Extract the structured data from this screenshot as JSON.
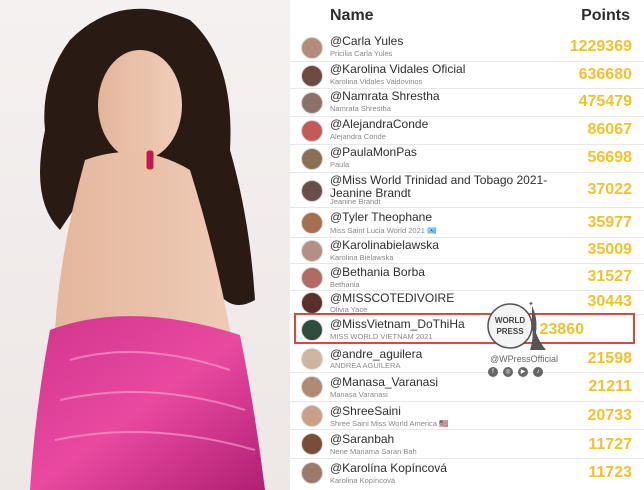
{
  "header": {
    "name_label": "Name",
    "points_label": "Points"
  },
  "rows": [
    {
      "username": "@Carla Yules",
      "fullname": "Pricilia Carla Yules",
      "points": "1229369",
      "color": "#b38b7b"
    },
    {
      "username": "@Karolina Vidales Oficial",
      "fullname": "Karolina Vidales Valdovinos",
      "points": "636680",
      "color": "#6d4b3e"
    },
    {
      "username": "@Namrata Shrestha",
      "fullname": "Namrata Shrestha",
      "points": "475479",
      "color": "#8e6f69"
    },
    {
      "username": "@AlejandraConde",
      "fullname": "Alejandra Conde",
      "points": "86067",
      "color": "#c45a58"
    },
    {
      "username": "@PaulaMonPas",
      "fullname": "Paula",
      "points": "56698",
      "color": "#8d6f55"
    },
    {
      "username": "@Miss World Trinidad and Tobago 2021- Jeanine Brandt",
      "fullname": "Jeanine Brandt",
      "points": "37022",
      "color": "#6a4f47"
    },
    {
      "username": "@Tyler Theophane",
      "fullname": "Miss Saint Lucia World 2021 🇱🇨",
      "points": "35977",
      "color": "#a56f4d"
    },
    {
      "username": "@Karolinabielawska",
      "fullname": "Karolina Bielawska",
      "points": "35009",
      "color": "#b29084"
    },
    {
      "username": "@Bethania Borba",
      "fullname": "Bethania",
      "points": "31527",
      "color": "#b36a63"
    },
    {
      "username": "@MISSCOTEDIVOIRE",
      "fullname": "Olivia Yace",
      "points": "30443",
      "color": "#5a2f2a"
    },
    {
      "username": "@MissVietnam_DoThiHa",
      "fullname": "MISS WORLD VIETNAM 2021",
      "points": "23860",
      "color": "#2e4d3a"
    },
    {
      "username": "@andre_aguilera",
      "fullname": "ANDREA AGUILERA",
      "points": "21598",
      "color": "#cfb59f"
    },
    {
      "username": "@Manasa_Varanasi",
      "fullname": "Manasa Varanasi",
      "points": "21211",
      "color": "#b08a71"
    },
    {
      "username": "@ShreeSaini",
      "fullname": "Shree Saini Miss World America 🇺🇸",
      "points": "20733",
      "color": "#c9a086"
    },
    {
      "username": "@Saranbah",
      "fullname": "Nene Mariama Saran Bah",
      "points": "11727",
      "color": "#7a4d3a"
    },
    {
      "username": "@Karolína Kopíncová",
      "fullname": "Karolina Kopíncová",
      "points": "11723",
      "color": "#9c7a69"
    }
  ],
  "watermark": {
    "logo_line1": "WORLD",
    "logo_line2": "PRESS",
    "handle": "@WPressOfficial",
    "socials": [
      "f",
      "◎",
      "▶",
      "♪"
    ]
  },
  "colors": {
    "points": "#f2c12e",
    "highlight": "#e0473a"
  }
}
